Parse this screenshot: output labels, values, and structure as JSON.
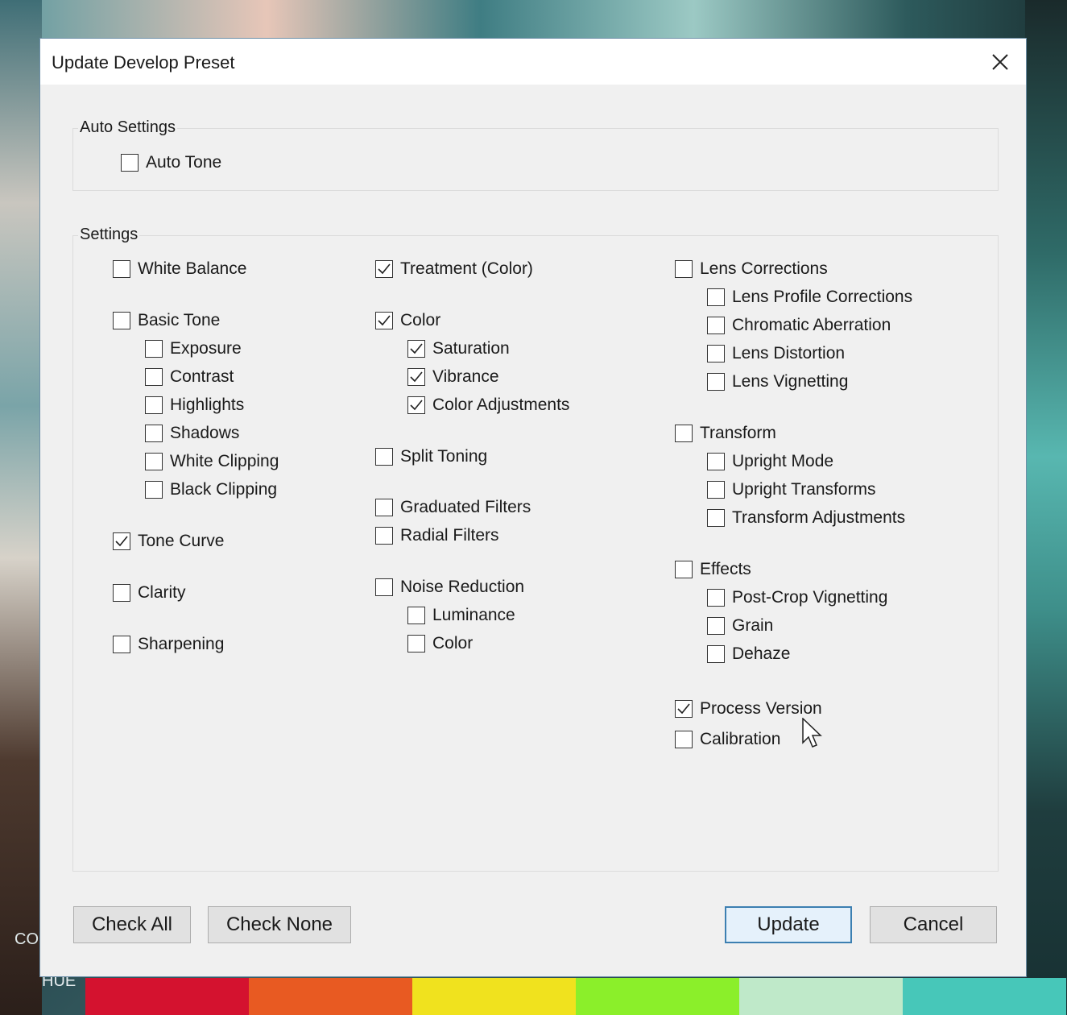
{
  "dialog": {
    "title": "Update Develop Preset"
  },
  "background": {
    "co_text": "CO",
    "hue_text": "HUE",
    "strip_colors": [
      "#d4122f",
      "#e85a22",
      "#f0e21e",
      "#8bef2a",
      "#bfe9c9",
      "#47c7b9"
    ]
  },
  "auto_settings": {
    "label": "Auto Settings",
    "items": [
      {
        "label": "Auto Tone",
        "checked": false
      }
    ]
  },
  "settings": {
    "label": "Settings",
    "col1": [
      {
        "label": "White Balance",
        "checked": false
      },
      {
        "label": "Basic Tone",
        "checked": false
      },
      {
        "label": "Exposure",
        "checked": false
      },
      {
        "label": "Contrast",
        "checked": false
      },
      {
        "label": "Highlights",
        "checked": false
      },
      {
        "label": "Shadows",
        "checked": false
      },
      {
        "label": "White Clipping",
        "checked": false
      },
      {
        "label": "Black Clipping",
        "checked": false
      },
      {
        "label": "Tone Curve",
        "checked": true
      },
      {
        "label": "Clarity",
        "checked": false
      },
      {
        "label": "Sharpening",
        "checked": false
      }
    ],
    "col2": [
      {
        "label": "Treatment (Color)",
        "checked": true
      },
      {
        "label": "Color",
        "checked": true
      },
      {
        "label": "Saturation",
        "checked": true
      },
      {
        "label": "Vibrance",
        "checked": true
      },
      {
        "label": "Color Adjustments",
        "checked": true
      },
      {
        "label": "Split Toning",
        "checked": false
      },
      {
        "label": "Graduated Filters",
        "checked": false
      },
      {
        "label": "Radial Filters",
        "checked": false
      },
      {
        "label": "Noise Reduction",
        "checked": false
      },
      {
        "label": "Luminance",
        "checked": false
      },
      {
        "label": "Color",
        "checked": false
      }
    ],
    "col3": [
      {
        "label": "Lens Corrections",
        "checked": false
      },
      {
        "label": "Lens Profile Corrections",
        "checked": false
      },
      {
        "label": "Chromatic Aberration",
        "checked": false
      },
      {
        "label": "Lens Distortion",
        "checked": false
      },
      {
        "label": "Lens Vignetting",
        "checked": false
      },
      {
        "label": "Transform",
        "checked": false
      },
      {
        "label": "Upright Mode",
        "checked": false
      },
      {
        "label": "Upright Transforms",
        "checked": false
      },
      {
        "label": "Transform Adjustments",
        "checked": false
      },
      {
        "label": "Effects",
        "checked": false
      },
      {
        "label": "Post-Crop Vignetting",
        "checked": false
      },
      {
        "label": "Grain",
        "checked": false
      },
      {
        "label": "Dehaze",
        "checked": false
      },
      {
        "label": "Process Version",
        "checked": true
      },
      {
        "label": "Calibration",
        "checked": false
      }
    ]
  },
  "buttons": {
    "check_all": "Check All",
    "check_none": "Check None",
    "update": "Update",
    "cancel": "Cancel"
  }
}
